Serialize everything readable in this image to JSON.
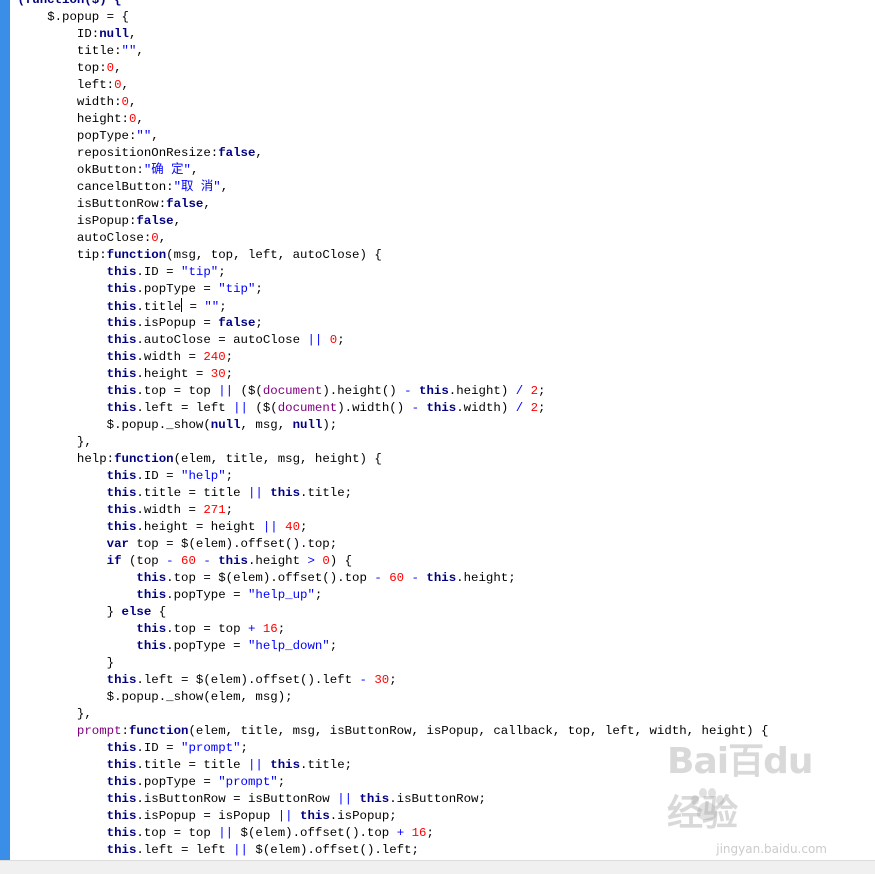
{
  "editor": {
    "caret_line_index": 18,
    "lines": [
      {
        "indent": 0,
        "tokens": [
          {
            "t": "(function($) {",
            "c": "kw"
          }
        ]
      },
      {
        "indent": 1,
        "tokens": [
          {
            "t": "$.popup = {"
          }
        ]
      },
      {
        "indent": 2,
        "tokens": [
          {
            "t": "ID:"
          },
          {
            "t": "null",
            "c": "kw"
          },
          {
            "t": ","
          }
        ]
      },
      {
        "indent": 2,
        "tokens": [
          {
            "t": "title:"
          },
          {
            "t": "\"\"",
            "c": "str"
          },
          {
            "t": ","
          }
        ]
      },
      {
        "indent": 2,
        "tokens": [
          {
            "t": "top:"
          },
          {
            "t": "0",
            "c": "num"
          },
          {
            "t": ","
          }
        ]
      },
      {
        "indent": 2,
        "tokens": [
          {
            "t": "left:"
          },
          {
            "t": "0",
            "c": "num"
          },
          {
            "t": ","
          }
        ]
      },
      {
        "indent": 2,
        "tokens": [
          {
            "t": "width:"
          },
          {
            "t": "0",
            "c": "num"
          },
          {
            "t": ","
          }
        ]
      },
      {
        "indent": 2,
        "tokens": [
          {
            "t": "height:"
          },
          {
            "t": "0",
            "c": "num"
          },
          {
            "t": ","
          }
        ]
      },
      {
        "indent": 2,
        "tokens": [
          {
            "t": "popType:"
          },
          {
            "t": "\"\"",
            "c": "str"
          },
          {
            "t": ","
          }
        ]
      },
      {
        "indent": 2,
        "tokens": [
          {
            "t": "repositionOnResize:"
          },
          {
            "t": "false",
            "c": "kw"
          },
          {
            "t": ","
          }
        ]
      },
      {
        "indent": 2,
        "tokens": [
          {
            "t": "okButton:"
          },
          {
            "t": "\"确 定\"",
            "c": "str"
          },
          {
            "t": ","
          }
        ]
      },
      {
        "indent": 2,
        "tokens": [
          {
            "t": "cancelButton:"
          },
          {
            "t": "\"取 消\"",
            "c": "str"
          },
          {
            "t": ","
          }
        ]
      },
      {
        "indent": 2,
        "tokens": [
          {
            "t": "isButtonRow:"
          },
          {
            "t": "false",
            "c": "kw"
          },
          {
            "t": ","
          }
        ]
      },
      {
        "indent": 2,
        "tokens": [
          {
            "t": "isPopup:"
          },
          {
            "t": "false",
            "c": "kw"
          },
          {
            "t": ","
          }
        ]
      },
      {
        "indent": 2,
        "tokens": [
          {
            "t": "autoClose:"
          },
          {
            "t": "0",
            "c": "num"
          },
          {
            "t": ","
          }
        ]
      },
      {
        "indent": 2,
        "tokens": [
          {
            "t": "tip:"
          },
          {
            "t": "function",
            "c": "kw"
          },
          {
            "t": "(msg, top, left, autoClose) {"
          }
        ]
      },
      {
        "indent": 3,
        "tokens": [
          {
            "t": "this",
            "c": "kw"
          },
          {
            "t": ".ID = "
          },
          {
            "t": "\"tip\"",
            "c": "str"
          },
          {
            "t": ";"
          }
        ]
      },
      {
        "indent": 3,
        "tokens": [
          {
            "t": "this",
            "c": "kw"
          },
          {
            "t": ".popType = "
          },
          {
            "t": "\"tip\"",
            "c": "str"
          },
          {
            "t": ";"
          }
        ]
      },
      {
        "indent": 3,
        "tokens": [
          {
            "t": "this",
            "c": "kw"
          },
          {
            "t": ".title"
          },
          {
            "t": "CARET",
            "c": "caret"
          },
          {
            "t": " = "
          },
          {
            "t": "\"\"",
            "c": "str"
          },
          {
            "t": ";"
          }
        ]
      },
      {
        "indent": 3,
        "tokens": [
          {
            "t": "this",
            "c": "kw"
          },
          {
            "t": ".isPopup = "
          },
          {
            "t": "false",
            "c": "kw"
          },
          {
            "t": ";"
          }
        ]
      },
      {
        "indent": 3,
        "tokens": [
          {
            "t": "this",
            "c": "kw"
          },
          {
            "t": ".autoClose = autoClose "
          },
          {
            "t": "||",
            "c": "op"
          },
          {
            "t": " "
          },
          {
            "t": "0",
            "c": "num"
          },
          {
            "t": ";"
          }
        ]
      },
      {
        "indent": 3,
        "tokens": [
          {
            "t": "this",
            "c": "kw"
          },
          {
            "t": ".width = "
          },
          {
            "t": "240",
            "c": "num"
          },
          {
            "t": ";"
          }
        ]
      },
      {
        "indent": 3,
        "tokens": [
          {
            "t": "this",
            "c": "kw"
          },
          {
            "t": ".height = "
          },
          {
            "t": "30",
            "c": "num"
          },
          {
            "t": ";"
          }
        ]
      },
      {
        "indent": 3,
        "tokens": [
          {
            "t": "this",
            "c": "kw"
          },
          {
            "t": ".top = top "
          },
          {
            "t": "||",
            "c": "op"
          },
          {
            "t": " ($("
          },
          {
            "t": "document",
            "c": "obj"
          },
          {
            "t": ").height() "
          },
          {
            "t": "-",
            "c": "op"
          },
          {
            "t": " "
          },
          {
            "t": "this",
            "c": "kw"
          },
          {
            "t": ".height) "
          },
          {
            "t": "/",
            "c": "op"
          },
          {
            "t": " "
          },
          {
            "t": "2",
            "c": "num"
          },
          {
            "t": ";"
          }
        ]
      },
      {
        "indent": 3,
        "tokens": [
          {
            "t": "this",
            "c": "kw"
          },
          {
            "t": ".left = left "
          },
          {
            "t": "||",
            "c": "op"
          },
          {
            "t": " ($("
          },
          {
            "t": "document",
            "c": "obj"
          },
          {
            "t": ").width() "
          },
          {
            "t": "-",
            "c": "op"
          },
          {
            "t": " "
          },
          {
            "t": "this",
            "c": "kw"
          },
          {
            "t": ".width) "
          },
          {
            "t": "/",
            "c": "op"
          },
          {
            "t": " "
          },
          {
            "t": "2",
            "c": "num"
          },
          {
            "t": ";"
          }
        ]
      },
      {
        "indent": 3,
        "tokens": [
          {
            "t": "$.popup._show("
          },
          {
            "t": "null",
            "c": "kw"
          },
          {
            "t": ", msg, "
          },
          {
            "t": "null",
            "c": "kw"
          },
          {
            "t": ");"
          }
        ]
      },
      {
        "indent": 2,
        "tokens": [
          {
            "t": "},"
          }
        ]
      },
      {
        "indent": 2,
        "tokens": [
          {
            "t": "help:"
          },
          {
            "t": "function",
            "c": "kw"
          },
          {
            "t": "(elem, title, msg, height) {"
          }
        ]
      },
      {
        "indent": 3,
        "tokens": [
          {
            "t": "this",
            "c": "kw"
          },
          {
            "t": ".ID = "
          },
          {
            "t": "\"help\"",
            "c": "str"
          },
          {
            "t": ";"
          }
        ]
      },
      {
        "indent": 3,
        "tokens": [
          {
            "t": "this",
            "c": "kw"
          },
          {
            "t": ".title = title "
          },
          {
            "t": "||",
            "c": "op"
          },
          {
            "t": " "
          },
          {
            "t": "this",
            "c": "kw"
          },
          {
            "t": ".title;"
          }
        ]
      },
      {
        "indent": 3,
        "tokens": [
          {
            "t": "this",
            "c": "kw"
          },
          {
            "t": ".width = "
          },
          {
            "t": "271",
            "c": "num"
          },
          {
            "t": ";"
          }
        ]
      },
      {
        "indent": 3,
        "tokens": [
          {
            "t": "this",
            "c": "kw"
          },
          {
            "t": ".height = height "
          },
          {
            "t": "||",
            "c": "op"
          },
          {
            "t": " "
          },
          {
            "t": "40",
            "c": "num"
          },
          {
            "t": ";"
          }
        ]
      },
      {
        "indent": 3,
        "tokens": [
          {
            "t": "var",
            "c": "kw"
          },
          {
            "t": " top = $(elem).offset().top;"
          }
        ]
      },
      {
        "indent": 3,
        "tokens": [
          {
            "t": "if",
            "c": "kw"
          },
          {
            "t": " (top "
          },
          {
            "t": "-",
            "c": "op"
          },
          {
            "t": " "
          },
          {
            "t": "60",
            "c": "num"
          },
          {
            "t": " "
          },
          {
            "t": "-",
            "c": "op"
          },
          {
            "t": " "
          },
          {
            "t": "this",
            "c": "kw"
          },
          {
            "t": ".height "
          },
          {
            "t": ">",
            "c": "op"
          },
          {
            "t": " "
          },
          {
            "t": "0",
            "c": "num"
          },
          {
            "t": ") {"
          }
        ]
      },
      {
        "indent": 4,
        "tokens": [
          {
            "t": "this",
            "c": "kw"
          },
          {
            "t": ".top = $(elem).offset().top "
          },
          {
            "t": "-",
            "c": "op"
          },
          {
            "t": " "
          },
          {
            "t": "60",
            "c": "num"
          },
          {
            "t": " "
          },
          {
            "t": "-",
            "c": "op"
          },
          {
            "t": " "
          },
          {
            "t": "this",
            "c": "kw"
          },
          {
            "t": ".height;"
          }
        ]
      },
      {
        "indent": 4,
        "tokens": [
          {
            "t": "this",
            "c": "kw"
          },
          {
            "t": ".popType = "
          },
          {
            "t": "\"help_up\"",
            "c": "str"
          },
          {
            "t": ";"
          }
        ]
      },
      {
        "indent": 3,
        "tokens": [
          {
            "t": "} "
          },
          {
            "t": "else",
            "c": "kw"
          },
          {
            "t": " {"
          }
        ]
      },
      {
        "indent": 4,
        "tokens": [
          {
            "t": "this",
            "c": "kw"
          },
          {
            "t": ".top = top "
          },
          {
            "t": "+",
            "c": "op"
          },
          {
            "t": " "
          },
          {
            "t": "16",
            "c": "num"
          },
          {
            "t": ";"
          }
        ]
      },
      {
        "indent": 4,
        "tokens": [
          {
            "t": "this",
            "c": "kw"
          },
          {
            "t": ".popType = "
          },
          {
            "t": "\"help_down\"",
            "c": "str"
          },
          {
            "t": ";"
          }
        ]
      },
      {
        "indent": 3,
        "tokens": [
          {
            "t": "}"
          }
        ]
      },
      {
        "indent": 3,
        "tokens": [
          {
            "t": "this",
            "c": "kw"
          },
          {
            "t": ".left = $(elem).offset().left "
          },
          {
            "t": "-",
            "c": "op"
          },
          {
            "t": " "
          },
          {
            "t": "30",
            "c": "num"
          },
          {
            "t": ";"
          }
        ]
      },
      {
        "indent": 3,
        "tokens": [
          {
            "t": "$.popup._show(elem, msg);"
          }
        ]
      },
      {
        "indent": 2,
        "tokens": [
          {
            "t": "},"
          }
        ]
      },
      {
        "indent": 2,
        "tokens": [
          {
            "t": "prompt",
            "c": "fn"
          },
          {
            "t": ":"
          },
          {
            "t": "function",
            "c": "kw"
          },
          {
            "t": "(elem, title, msg, isButtonRow, isPopup, callback, top, left, width, height) {"
          }
        ]
      },
      {
        "indent": 3,
        "tokens": [
          {
            "t": "this",
            "c": "kw"
          },
          {
            "t": ".ID = "
          },
          {
            "t": "\"prompt\"",
            "c": "str"
          },
          {
            "t": ";"
          }
        ]
      },
      {
        "indent": 3,
        "tokens": [
          {
            "t": "this",
            "c": "kw"
          },
          {
            "t": ".title = title "
          },
          {
            "t": "||",
            "c": "op"
          },
          {
            "t": " "
          },
          {
            "t": "this",
            "c": "kw"
          },
          {
            "t": ".title;"
          }
        ]
      },
      {
        "indent": 3,
        "tokens": [
          {
            "t": "this",
            "c": "kw"
          },
          {
            "t": ".popType = "
          },
          {
            "t": "\"prompt\"",
            "c": "str"
          },
          {
            "t": ";"
          }
        ]
      },
      {
        "indent": 3,
        "tokens": [
          {
            "t": "this",
            "c": "kw"
          },
          {
            "t": ".isButtonRow = isButtonRow "
          },
          {
            "t": "||",
            "c": "op"
          },
          {
            "t": " "
          },
          {
            "t": "this",
            "c": "kw"
          },
          {
            "t": ".isButtonRow;"
          }
        ]
      },
      {
        "indent": 3,
        "tokens": [
          {
            "t": "this",
            "c": "kw"
          },
          {
            "t": ".isPopup = isPopup "
          },
          {
            "t": "||",
            "c": "op"
          },
          {
            "t": " "
          },
          {
            "t": "this",
            "c": "kw"
          },
          {
            "t": ".isPopup;"
          }
        ]
      },
      {
        "indent": 3,
        "tokens": [
          {
            "t": "this",
            "c": "kw"
          },
          {
            "t": ".top = top "
          },
          {
            "t": "||",
            "c": "op"
          },
          {
            "t": " $(elem).offset().top "
          },
          {
            "t": "+",
            "c": "op"
          },
          {
            "t": " "
          },
          {
            "t": "16",
            "c": "num"
          },
          {
            "t": ";"
          }
        ]
      },
      {
        "indent": 3,
        "tokens": [
          {
            "t": "this",
            "c": "kw"
          },
          {
            "t": ".left = left "
          },
          {
            "t": "||",
            "c": "op"
          },
          {
            "t": " $(elem).offset().left;"
          }
        ]
      }
    ]
  },
  "watermark": {
    "logo_text": "Bai百du经验",
    "url": "jingyan.baidu.com"
  },
  "colors": {
    "gutter": "#3b8ee8",
    "keyword": "#000080",
    "string": "#0000ff",
    "number": "#ff0000"
  }
}
